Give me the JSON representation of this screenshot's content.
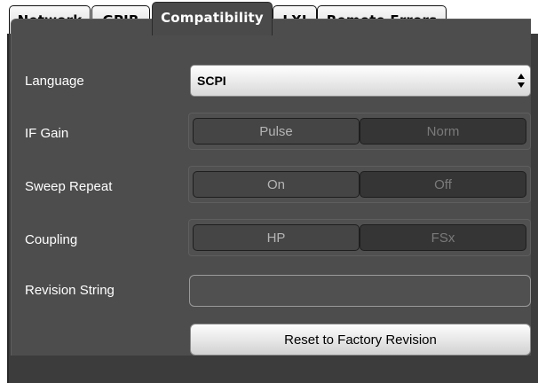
{
  "tabs": [
    {
      "label": "Network",
      "active": false
    },
    {
      "label": "GPIB",
      "active": false
    },
    {
      "label": "Compatibility",
      "active": true
    },
    {
      "label": "LXI",
      "active": false
    },
    {
      "label": "Remote Errors",
      "active": false
    }
  ],
  "settings": {
    "language": {
      "label": "Language",
      "value": "SCPI",
      "icon": "updown-arrows-icon"
    },
    "if_gain": {
      "label": "IF Gain",
      "options": [
        "Pulse",
        "Norm"
      ]
    },
    "sweep_repeat": {
      "label": "Sweep Repeat",
      "options": [
        "On",
        "Off"
      ]
    },
    "coupling": {
      "label": "Coupling",
      "options": [
        "HP",
        "FSx"
      ]
    },
    "revision_string": {
      "label": "Revision String",
      "value": ""
    },
    "reset_button": {
      "label": "Reset to Factory Revision"
    }
  },
  "colors": {
    "panel_bg": "#4d4d4d",
    "active_tab": "#4a4a4a",
    "label_text": "#ffffff"
  }
}
